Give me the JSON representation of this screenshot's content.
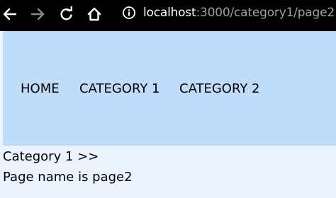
{
  "browser": {
    "url_host": "localhost",
    "url_rest": ":3000/category1/page2",
    "icons": {
      "back": "arrow-left-icon",
      "forward": "arrow-right-icon",
      "reload": "reload-icon",
      "home": "home-icon",
      "info": "info-icon"
    },
    "colors": {
      "bar": "#000000",
      "url_host": "#ffffff",
      "url_rest": "#9aa0a6",
      "forward_disabled": "#8a8a8a"
    }
  },
  "nav": {
    "items": [
      {
        "label": "HOME"
      },
      {
        "label": "CATEGORY 1"
      },
      {
        "label": "CATEGORY 2"
      }
    ],
    "background": "#c0dcfb"
  },
  "main": {
    "breadcrumb": "Category 1 >>",
    "page_name": "Page name is page2",
    "background": "#ebf3ff"
  }
}
